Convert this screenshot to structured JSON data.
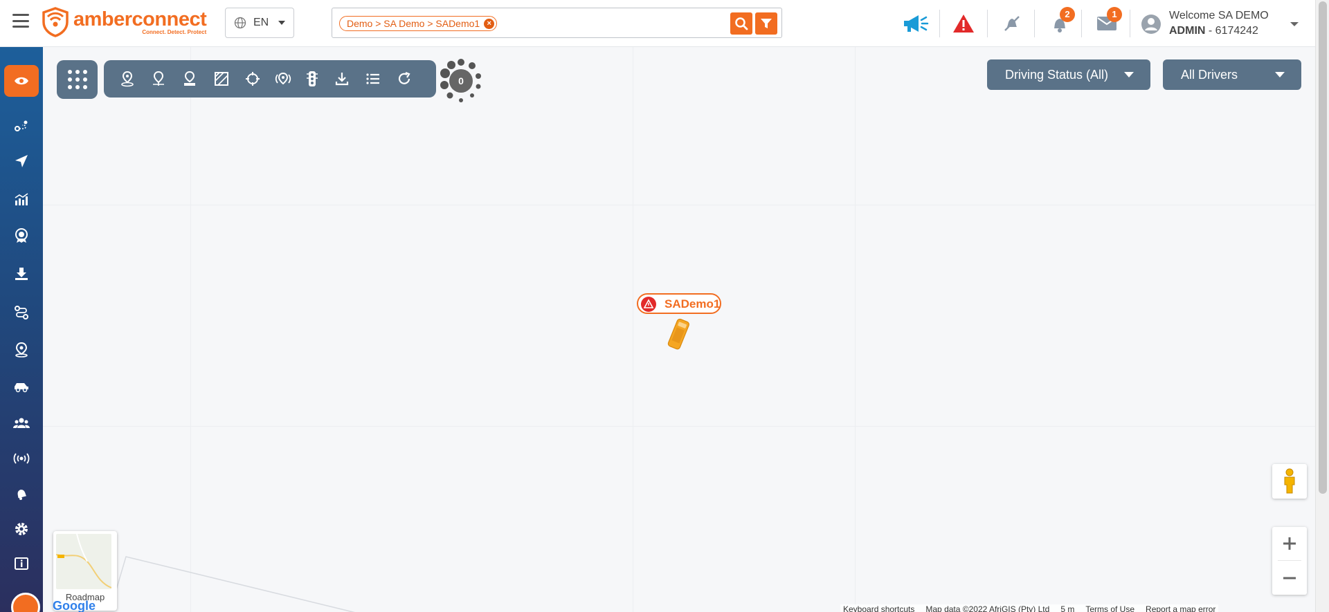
{
  "header": {
    "logo": {
      "name": "amberconnect",
      "tagline": "Connect. Detect. Protect"
    },
    "language": "EN",
    "search": {
      "chip": "Demo > SA Demo > SADemo1",
      "chip_remove": "×"
    },
    "notifications": {
      "alerts_count": "2",
      "messages_count": "1"
    },
    "user": {
      "welcome": "Welcome SA DEMO",
      "role": "ADMIN",
      "account": "- 6174242"
    }
  },
  "sidebar": {
    "items": [
      {
        "icon": "eye-icon",
        "active": true
      },
      {
        "icon": "route-icon"
      },
      {
        "icon": "navigation-icon"
      },
      {
        "icon": "analytics-icon"
      },
      {
        "icon": "award-icon"
      },
      {
        "icon": "download-icon"
      },
      {
        "icon": "trip-icon"
      },
      {
        "icon": "location-icon"
      },
      {
        "icon": "vehicle-icon"
      },
      {
        "icon": "users-icon"
      },
      {
        "icon": "signal-icon"
      },
      {
        "icon": "bell-icon"
      },
      {
        "icon": "gear-icon"
      },
      {
        "icon": "info-icon"
      }
    ]
  },
  "toolbar": {
    "cluster_count": "0"
  },
  "filters": {
    "driving_status": "Driving Status (All)",
    "drivers": "All Drivers"
  },
  "vehicle": {
    "name": "SADemo1",
    "status_color": "#e22a2a",
    "color": "#f5a623"
  },
  "map": {
    "roadmap_label": "Roadmap",
    "google": "Google",
    "attribution": {
      "shortcuts": "Keyboard shortcuts",
      "data": "Map data ©2022 AfriGIS (Pty) Ltd",
      "scale": "5 m",
      "terms": "Terms of Use",
      "report": "Report a map error"
    }
  },
  "colors": {
    "accent": "#f26d21",
    "toolbar": "#5a7288",
    "sidebar_top": "#1d5f9b",
    "sidebar_bottom": "#2b2f5e"
  }
}
